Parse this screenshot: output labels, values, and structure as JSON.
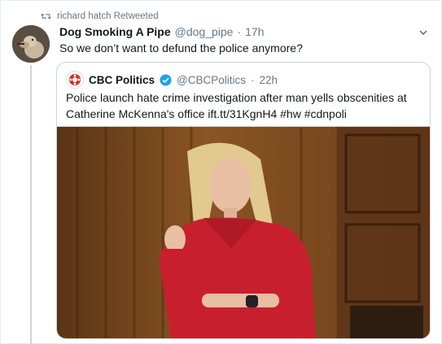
{
  "retweet": {
    "text": "richard hatch Retweeted"
  },
  "tweet": {
    "author_name": "Dog Smoking A Pipe",
    "handle": "@dog_pipe",
    "separator": "·",
    "time": "17h",
    "text": "So we don’t want to defund the police anymore?"
  },
  "quoted": {
    "author_name": "CBC Politics",
    "handle": "@CBCPolitics",
    "separator": "·",
    "time": "22h",
    "text": "Police launch hate crime investigation after man yells obscenities at Catherine McKenna's office ift.tt/31KgnH4 #hw #cdnpoli"
  },
  "colors": {
    "verified": "#1da1f2",
    "muted": "#657786",
    "border": "#ccd6dd"
  }
}
